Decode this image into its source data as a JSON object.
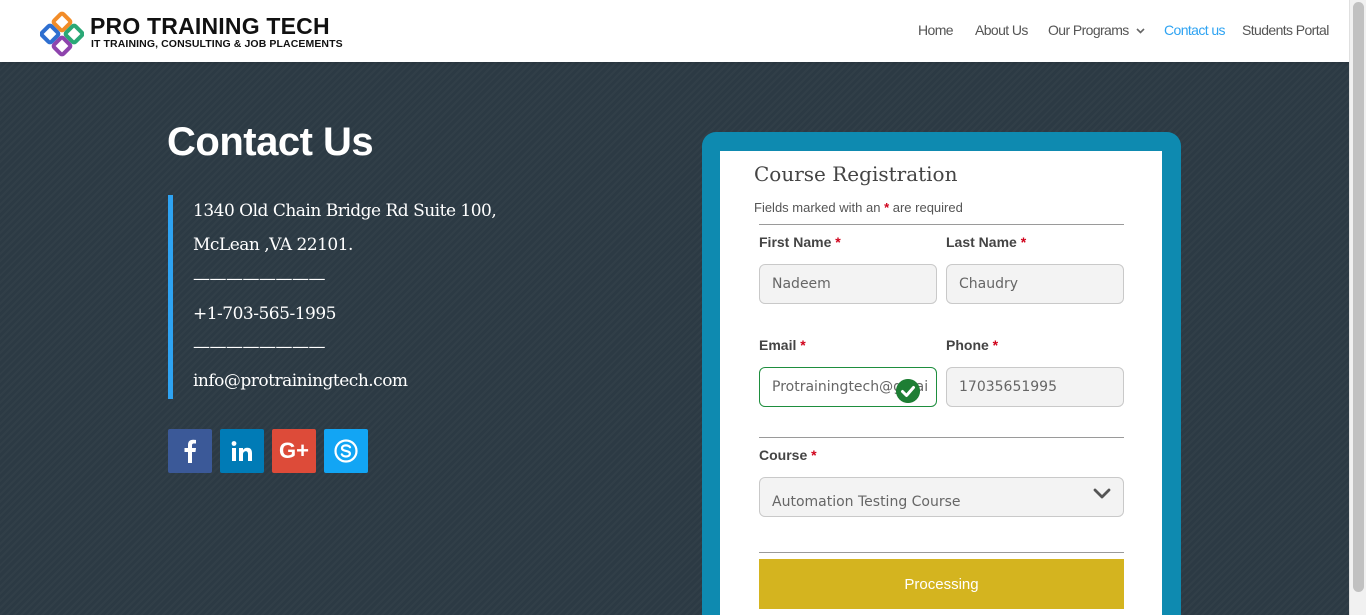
{
  "header": {
    "logo": {
      "title": "PRO TRAINING TECH",
      "subtitle": "IT TRAINING, CONSULTING & JOB PLACEMENTS"
    },
    "nav": [
      {
        "label": "Home"
      },
      {
        "label": "About Us"
      },
      {
        "label": "Our Programs"
      },
      {
        "label": "Contact us",
        "active": true
      },
      {
        "label": "Students Portal"
      }
    ],
    "active_color": "#2ea3f2"
  },
  "contact": {
    "title": "Contact Us",
    "address_line1": "1340 Old Chain Bridge Rd Suite 100,",
    "address_line2": "McLean ,VA  22101.",
    "separator": "————————",
    "phone": "+1-703-565-1995",
    "email": "info@protrainingtech.com",
    "socials": [
      {
        "name": "facebook-icon",
        "glyph": "f",
        "color": "#3b5998"
      },
      {
        "name": "linkedin-icon",
        "glyph": "in",
        "color": "#007bb6"
      },
      {
        "name": "google-plus-icon",
        "glyph": "G+",
        "color": "#dd4b39"
      },
      {
        "name": "skype-icon",
        "glyph": "S",
        "color": "#12a5f4"
      }
    ]
  },
  "form": {
    "title": "Course Registration",
    "note_prefix": "Fields marked with an ",
    "note_star": "*",
    "note_suffix": " are required",
    "required_mark": "*",
    "first_name": {
      "label": "First Name",
      "value": "Nadeem"
    },
    "last_name": {
      "label": "Last Name",
      "value": "Chaudry"
    },
    "email": {
      "label": "Email",
      "value": "Protrainingtech@gmai"
    },
    "phone": {
      "label": "Phone",
      "value": "17035651995"
    },
    "course": {
      "label": "Course",
      "selected": "Automation Testing Course"
    },
    "submit_label": "Processing",
    "submit_color": "#d4b41f",
    "frame_color": "#0e8ab0"
  }
}
